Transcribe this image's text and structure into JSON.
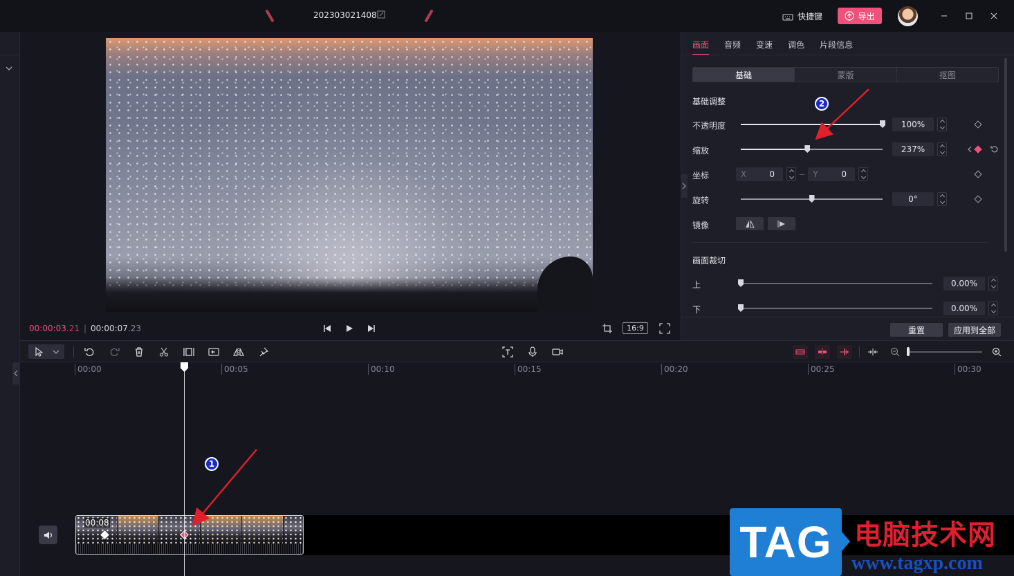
{
  "titlebar": {
    "project_name": "202303021408",
    "shortcut_label": "快捷键",
    "export_label": "导出"
  },
  "preview": {
    "current_time_main": "00:00:03",
    "current_time_frac": ".21",
    "total_time_main": "00:00:07",
    "total_time_frac": ".23",
    "ratio_label": "16:9"
  },
  "panel": {
    "tabs": [
      "画面",
      "音频",
      "变速",
      "调色",
      "片段信息"
    ],
    "active_tab": 0,
    "segments": [
      "基础",
      "蒙版",
      "抠图"
    ],
    "active_segment": 0,
    "basic_section_title": "基础调整",
    "opacity": {
      "label": "不透明度",
      "value": "100%",
      "level_percent": 100
    },
    "scale": {
      "label": "缩放",
      "value": "237%",
      "level_percent": 47
    },
    "position": {
      "label": "坐标",
      "x_axis": "X",
      "x_value": "0",
      "y_axis": "Y",
      "y_value": "0"
    },
    "rotation": {
      "label": "旋转",
      "value": "0°",
      "level_percent": 50
    },
    "mirror": {
      "label": "镜像"
    },
    "crop_section_title": "画面裁切",
    "crop_top": {
      "label": "上",
      "value": "0.00%"
    },
    "crop_bottom": {
      "label": "下",
      "value": "0.00%"
    },
    "reset_label": "重置",
    "apply_all_label": "应用到全部"
  },
  "timeline": {
    "ticks": [
      "00:00",
      "00:05",
      "00:10",
      "00:15",
      "00:20",
      "00:25",
      "00:30"
    ],
    "clip_duration": "00:08"
  },
  "annotations": {
    "badge_1": "1",
    "badge_2": "2"
  },
  "watermark": {
    "tag": "TAG",
    "cn": "电脑技术网",
    "url": "www.tagxp.com"
  },
  "colors": {
    "accent": "#f0507a",
    "badge_blue": "#1a28d0",
    "arrow_red": "#e0202a"
  }
}
